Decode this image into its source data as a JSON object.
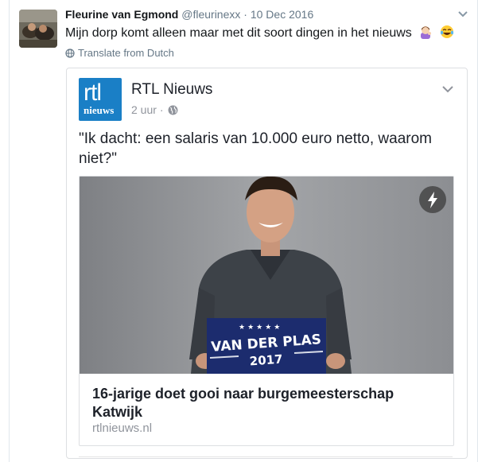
{
  "tweet": {
    "author_name": "Fleurine van Egmond",
    "author_handle": "@fleurinexx",
    "separator": "·",
    "date": "10 Dec 2016",
    "text": "Mijn dorp komt alleen maar met dit soort dingen in het nieuws",
    "emojis": [
      "woman-tipping-hand-icon",
      "laughing-tears-icon"
    ],
    "translate_label": "Translate from Dutch"
  },
  "facebook_post": {
    "page_name": "RTL Nieuws",
    "logo": {
      "line1": "rtl",
      "line2": "nieuws"
    },
    "time": "2 uur",
    "meta_separator": "·",
    "text": "\"Ik dacht: een salaris van 10.000 euro netto, waarom niet?\"",
    "link": {
      "headline": "16-jarige doet gooi naar burgemeesterschap Katwijk",
      "domain": "rtlnieuws.nl",
      "sign": {
        "line1": "VAN DER PLAS",
        "line2": "2017"
      }
    }
  },
  "colors": {
    "rtl_blue": "#1a7fc6",
    "sign_navy": "#1c2c6e",
    "twitter_gray": "#657786"
  }
}
